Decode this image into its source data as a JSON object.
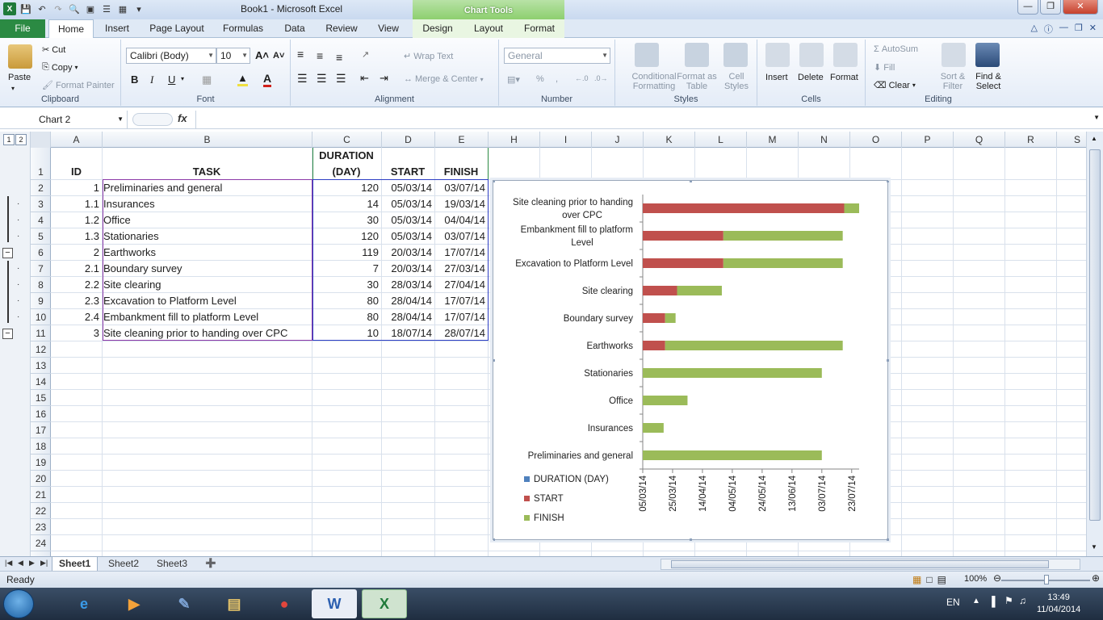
{
  "window": {
    "title": "Book1  -  Microsoft Excel",
    "context_tab_group": "Chart Tools"
  },
  "ribbon_tabs": [
    "File",
    "Home",
    "Insert",
    "Page Layout",
    "Formulas",
    "Data",
    "Review",
    "View",
    "Design",
    "Layout",
    "Format"
  ],
  "ribbon": {
    "clipboard": {
      "paste": "Paste",
      "cut": "Cut",
      "copy": "Copy",
      "format_painter": "Format Painter",
      "label": "Clipboard"
    },
    "font": {
      "name": "Calibri (Body)",
      "size": "10",
      "label": "Font"
    },
    "alignment": {
      "wrap_text": "Wrap Text",
      "merge_center": "Merge & Center",
      "label": "Alignment"
    },
    "number": {
      "format": "General",
      "label": "Number"
    },
    "styles": {
      "conditional": "Conditional Formatting",
      "format_table": "Format as Table",
      "cell_styles": "Cell Styles",
      "label": "Styles"
    },
    "cells": {
      "insert": "Insert",
      "delete": "Delete",
      "format": "Format",
      "label": "Cells"
    },
    "editing": {
      "autosum": "AutoSum",
      "fill": "Fill",
      "clear": "Clear",
      "sort_filter": "Sort & Filter",
      "find_select": "Find & Select",
      "label": "Editing"
    }
  },
  "formula_bar": {
    "name_box": "Chart 2",
    "fx": "fx"
  },
  "outline_levels": [
    "1",
    "2"
  ],
  "columns": [
    "A",
    "B",
    "C",
    "D",
    "E",
    "H",
    "I",
    "J",
    "K",
    "L",
    "M",
    "N",
    "O",
    "P",
    "Q",
    "R",
    "S"
  ],
  "row_numbers": [
    "1",
    "2",
    "3",
    "4",
    "5",
    "6",
    "7",
    "8",
    "9",
    "10",
    "11",
    "12",
    "13",
    "14",
    "15",
    "16",
    "17",
    "18",
    "19",
    "20",
    "21",
    "22",
    "23",
    "24"
  ],
  "table": {
    "headers": {
      "id": "ID",
      "task": "TASK",
      "duration_line1": "DURATION",
      "duration_line2": "(DAY)",
      "start": "START",
      "finish": "FINISH"
    },
    "rows": [
      {
        "id": "1",
        "task": "Preliminaries and general",
        "duration": "120",
        "start": "05/03/14",
        "finish": "03/07/14"
      },
      {
        "id": "1.1",
        "task": "Insurances",
        "duration": "14",
        "start": "05/03/14",
        "finish": "19/03/14"
      },
      {
        "id": "1.2",
        "task": "Office",
        "duration": "30",
        "start": "05/03/14",
        "finish": "04/04/14"
      },
      {
        "id": "1.3",
        "task": "Stationaries",
        "duration": "120",
        "start": "05/03/14",
        "finish": "03/07/14"
      },
      {
        "id": "2",
        "task": "Earthworks",
        "duration": "119",
        "start": "20/03/14",
        "finish": "17/07/14"
      },
      {
        "id": "2.1",
        "task": "Boundary survey",
        "duration": "7",
        "start": "20/03/14",
        "finish": "27/03/14"
      },
      {
        "id": "2.2",
        "task": "Site clearing",
        "duration": "30",
        "start": "28/03/14",
        "finish": "27/04/14"
      },
      {
        "id": "2.3",
        "task": "Excavation to Platform Level",
        "duration": "80",
        "start": "28/04/14",
        "finish": "17/07/14"
      },
      {
        "id": "2.4",
        "task": "Embankment fill to platform Level",
        "duration": "80",
        "start": "28/04/14",
        "finish": "17/07/14"
      },
      {
        "id": "3",
        "task": "Site cleaning prior to handing over CPC",
        "duration": "10",
        "start": "18/07/14",
        "finish": "28/07/14"
      }
    ]
  },
  "chart_data": {
    "type": "bar",
    "orientation": "horizontal",
    "stacked": true,
    "categories": [
      "Preliminaries and general",
      "Insurances",
      "Office",
      "Stationaries",
      "Earthworks",
      "Boundary survey",
      "Site clearing",
      "Excavation to Platform Level",
      "Embankment fill to platform Level",
      "Site cleaning prior to handing over CPC"
    ],
    "category_display": [
      "Preliminaries and general",
      "Insurances",
      "Office",
      "Stationaries",
      "Earthworks",
      "Boundary survey",
      "Site clearing",
      "Excavation to Platform Level",
      "Embankment fill to platform|Level",
      "Site cleaning prior to handing|over CPC"
    ],
    "series": [
      {
        "name": "DURATION (DAY)",
        "color": "#4f81bd",
        "values": [
          120,
          14,
          30,
          120,
          119,
          7,
          30,
          80,
          80,
          10
        ]
      },
      {
        "name": "START",
        "color": "#c0504d",
        "values": [
          "2014-03-05",
          "2014-03-05",
          "2014-03-05",
          "2014-03-05",
          "2014-03-20",
          "2014-03-20",
          "2014-03-28",
          "2014-04-28",
          "2014-04-28",
          "2014-07-18"
        ]
      },
      {
        "name": "FINISH",
        "color": "#9bbb59",
        "values": [
          "2014-07-03",
          "2014-03-19",
          "2014-04-04",
          "2014-07-03",
          "2014-07-17",
          "2014-03-27",
          "2014-04-27",
          "2014-07-17",
          "2014-07-17",
          "2014-07-28"
        ]
      }
    ],
    "x_ticks": [
      "05/03/14",
      "25/03/14",
      "14/04/14",
      "04/05/14",
      "24/05/14",
      "13/06/14",
      "03/07/14",
      "23/07/14"
    ],
    "xlim": [
      "2014-03-05",
      "2014-07-28"
    ],
    "legend": "bottom-left",
    "grid": false
  },
  "sheets": [
    "Sheet1",
    "Sheet2",
    "Sheet3"
  ],
  "status": {
    "ready": "Ready",
    "zoom": "100%"
  },
  "taskbar": {
    "lang": "EN",
    "time": "13:49",
    "date": "11/04/2014"
  }
}
